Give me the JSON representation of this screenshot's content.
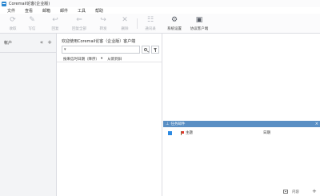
{
  "window": {
    "title": "Coremail论客(企业版)"
  },
  "menu": [
    "文件",
    "查看",
    "邮箱",
    "邮件",
    "工具",
    "帮助"
  ],
  "toolbar": {
    "items": [
      {
        "label": "收取",
        "icon": "refresh-icon"
      },
      {
        "label": "写信",
        "icon": "compose-icon"
      },
      {
        "label": "回复",
        "icon": "reply-icon"
      },
      {
        "label": "回复全部",
        "icon": "reply-all-icon"
      },
      {
        "label": "转发",
        "icon": "forward-icon"
      },
      {
        "label": "删除",
        "icon": "delete-icon"
      },
      {
        "label": "通讯录",
        "icon": "contacts-icon"
      },
      {
        "label": "系统设置",
        "icon": "gear-icon"
      },
      {
        "label": "协议客户端",
        "icon": "client-icon"
      }
    ]
  },
  "sidebar": {
    "title": "帐户",
    "collapse": "«",
    "add": "+"
  },
  "mail_list": {
    "account_line": "欢迎使用Coremail论客（企业版）客户端",
    "search": {
      "caret": "▾",
      "value": ""
    },
    "sort": {
      "by": "按来信时日期（降序）",
      "arrow": "▾",
      "from": "从新到旧"
    }
  },
  "tasks": {
    "pin": "⊥",
    "title": "任务邮件",
    "close": "×",
    "rows": [
      {
        "subject": "主题",
        "date": "日期"
      }
    ]
  },
  "status": {
    "text": "内容"
  },
  "colors": {
    "task_header": "#5a8fc4",
    "checkbox": "#2d8ae2",
    "flag": "#e0362c",
    "app_icon": "#2b87d1"
  }
}
